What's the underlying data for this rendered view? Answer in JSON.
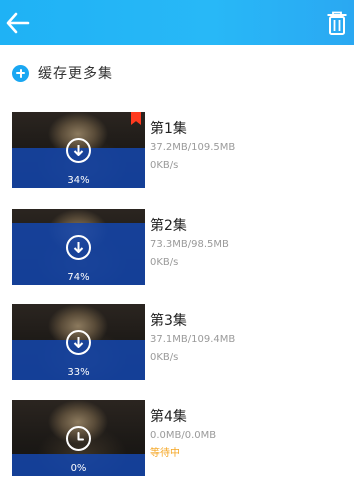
{
  "header": {
    "back_icon": "arrow-left-icon",
    "delete_icon": "trash-icon",
    "background": "#1fb2f5"
  },
  "cache_more": {
    "label": "缓存更多集",
    "icon": "plus-circle-icon",
    "icon_color": "#1aa7f2"
  },
  "downloads": [
    {
      "title": "第1集",
      "size": "37.2MB/109.5MB",
      "status": "0KB/s",
      "progress_label": "34%",
      "progress": 0.34,
      "state": "downloading",
      "bookmarked": true
    },
    {
      "title": "第2集",
      "size": "73.3MB/98.5MB",
      "status": "0KB/s",
      "progress_label": "74%",
      "progress": 0.74,
      "state": "downloading"
    },
    {
      "title": "第3集",
      "size": "37.1MB/109.4MB",
      "status": "0KB/s",
      "progress_label": "33%",
      "progress": 0.33,
      "state": "downloading"
    },
    {
      "title": "第4集",
      "size": "0.0MB/0.0MB",
      "status": "等待中",
      "progress_label": "0%",
      "progress": 0,
      "state": "waiting",
      "status_color": "#f5a623"
    }
  ]
}
